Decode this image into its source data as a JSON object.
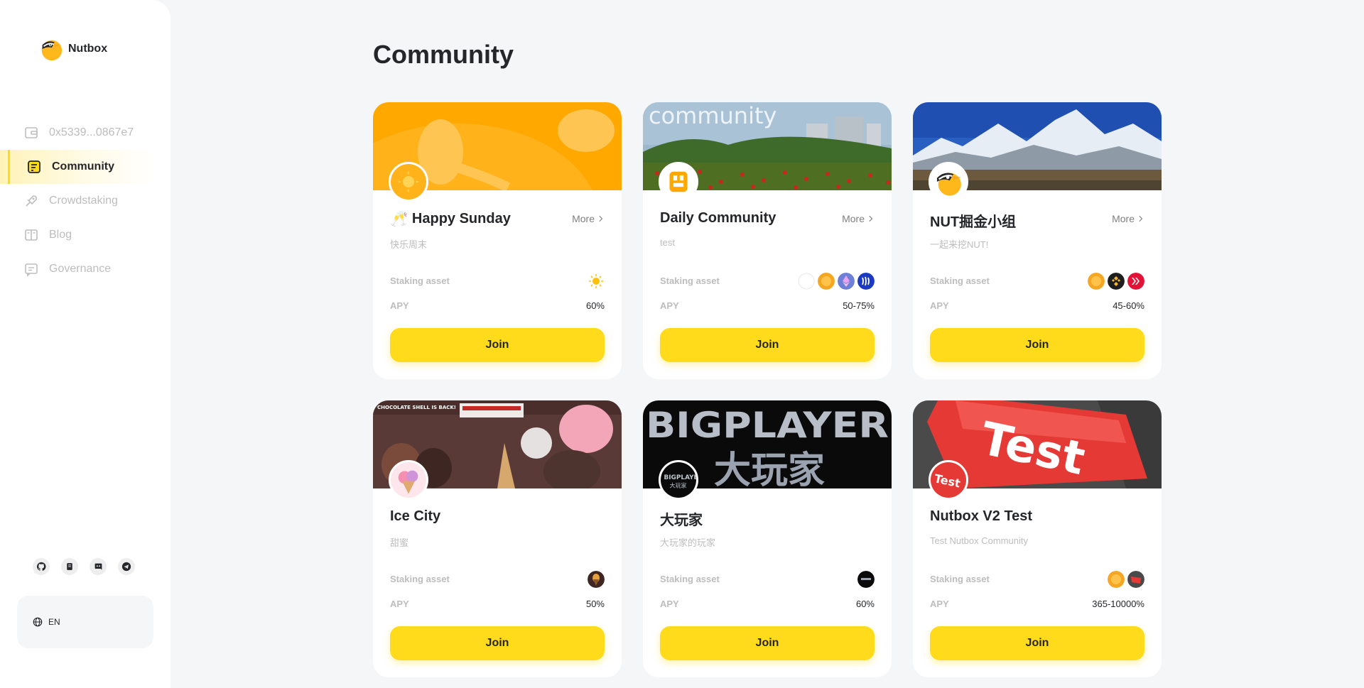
{
  "brand": {
    "name": "Nutbox"
  },
  "sidebar": {
    "items": [
      {
        "label": "0x5339...0867e7",
        "icon": "wallet-icon"
      },
      {
        "label": "Community",
        "icon": "community-icon",
        "active": true
      },
      {
        "label": "Crowdstaking",
        "icon": "crowdstaking-icon"
      },
      {
        "label": "Blog",
        "icon": "blog-icon"
      },
      {
        "label": "Governance",
        "icon": "governance-icon"
      }
    ],
    "social": [
      "github-icon",
      "docs-icon",
      "discord-icon",
      "telegram-icon"
    ],
    "language": "EN"
  },
  "page": {
    "title": "Community"
  },
  "labels": {
    "staking_asset": "Staking asset",
    "apy": "APY",
    "more": "More",
    "join": "Join"
  },
  "communities": [
    {
      "title": "Happy Sunday",
      "emoji": "🥂",
      "description": "快乐周末",
      "apy": "60%",
      "assets": [
        "sun-token-icon"
      ]
    },
    {
      "title": "Daily Community",
      "description": "test",
      "apy": "50-75%",
      "assets": [
        "blank-token-icon",
        "nut-token-icon",
        "eth-token-icon",
        "steem-token-icon"
      ]
    },
    {
      "title": "NUT掘金小组",
      "description": "一起来挖NUT!",
      "apy": "45-60%",
      "assets": [
        "nut-token-icon",
        "bnb-token-icon",
        "hive-token-icon"
      ]
    },
    {
      "title": "Ice City",
      "description": "甜蜜",
      "apy": "50%",
      "assets": [
        "ice-city-token-icon"
      ]
    },
    {
      "title": "大玩家",
      "description": "大玩家的玩家",
      "apy": "60%",
      "assets": [
        "bigplayer-token-icon"
      ]
    },
    {
      "title": "Nutbox V2 Test",
      "description": "Test Nutbox Community",
      "apy": "365-10000%",
      "assets": [
        "nut-token-icon",
        "test-token-icon"
      ]
    }
  ]
}
